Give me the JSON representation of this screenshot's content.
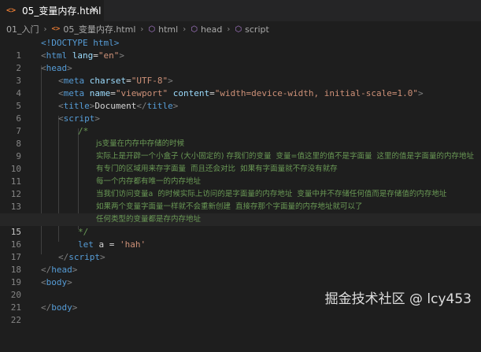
{
  "tab": {
    "icon": "<>",
    "label": "05_变量内存.html",
    "close": "×"
  },
  "breadcrumb": {
    "folder": "01_入门",
    "file": "05_变量内存.html",
    "html": "html",
    "head": "head",
    "script": "script"
  },
  "watermark": "掘金技术社区 @ lcy453",
  "code": {
    "doctype": "<!DOCTYPE html>",
    "html_open": "html",
    "lang_attr": "lang",
    "lang_val": "\"en\"",
    "head": "head",
    "meta": "meta",
    "charset_attr": "charset",
    "charset_val": "\"UTF-8\"",
    "name_attr": "name",
    "name_val": "\"viewport\"",
    "content_attr": "content",
    "content_val": "\"width=device-width, initial-scale=1.0\"",
    "title": "title",
    "title_text": "Document",
    "script": "script",
    "comment_open": "/*",
    "c1": "js变量在内存中存储的时候",
    "c2": "实际上是开辟一个小盒子 (大小固定的) 存我们的变量  变量=值这里的值不是字面量  这里的值是字面量的内存地址",
    "c3": "有专门的区域用来存字面量  而且还会对比  如果有字面量就不存没有就存",
    "c4": "每一个内存都有唯一的内存地址",
    "c5": "当我们访问变量a  的时候实际上访问的是字面量的内存地址  变量中并不存储任何值而是存储值的内存地址",
    "c6": "如果两个变量字面量一样就不会重新创建  直接存那个字面量的内存地址就可以了",
    "c7": "任何类型的变量都是存内存地址",
    "comment_close": "*/",
    "let": "let",
    "let_rest": " a = ",
    "let_val": "'hah'",
    "body": "body"
  }
}
